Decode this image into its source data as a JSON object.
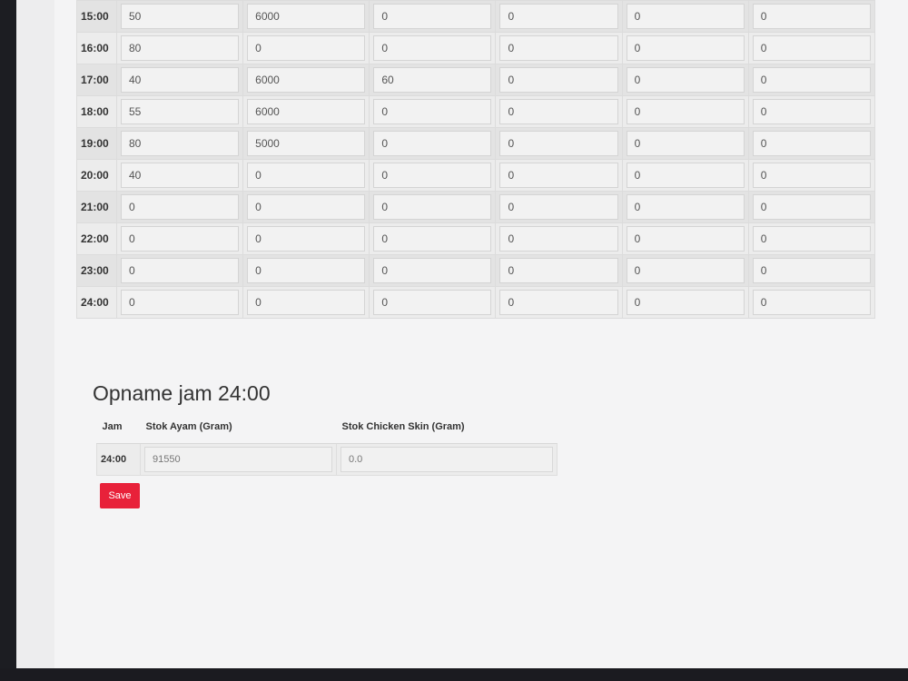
{
  "hourly": {
    "rows": [
      {
        "time": "15:00",
        "values": [
          "50",
          "6000",
          "0",
          "0",
          "0",
          "0"
        ]
      },
      {
        "time": "16:00",
        "values": [
          "80",
          "0",
          "0",
          "0",
          "0",
          "0"
        ]
      },
      {
        "time": "17:00",
        "values": [
          "40",
          "6000",
          "60",
          "0",
          "0",
          "0"
        ]
      },
      {
        "time": "18:00",
        "values": [
          "55",
          "6000",
          "0",
          "0",
          "0",
          "0"
        ]
      },
      {
        "time": "19:00",
        "values": [
          "80",
          "5000",
          "0",
          "0",
          "0",
          "0"
        ]
      },
      {
        "time": "20:00",
        "values": [
          "40",
          "0",
          "0",
          "0",
          "0",
          "0"
        ]
      },
      {
        "time": "21:00",
        "values": [
          "0",
          "0",
          "0",
          "0",
          "0",
          "0"
        ]
      },
      {
        "time": "22:00",
        "values": [
          "0",
          "0",
          "0",
          "0",
          "0",
          "0"
        ]
      },
      {
        "time": "23:00",
        "values": [
          "0",
          "0",
          "0",
          "0",
          "0",
          "0"
        ]
      },
      {
        "time": "24:00",
        "values": [
          "0",
          "0",
          "0",
          "0",
          "0",
          "0"
        ]
      }
    ]
  },
  "opname": {
    "title": "Opname jam 24:00",
    "headers": {
      "jam": "Jam",
      "stok_ayam": "Stok Ayam (Gram)",
      "stok_chicken_skin": "Stok Chicken Skin (Gram)"
    },
    "row": {
      "jam": "24:00",
      "stok_ayam": "91550",
      "stok_chicken_skin": "0.0"
    }
  },
  "save_label": "Save",
  "colors": {
    "save_button": "#e8213a",
    "page_background": "#f4f4f5"
  }
}
